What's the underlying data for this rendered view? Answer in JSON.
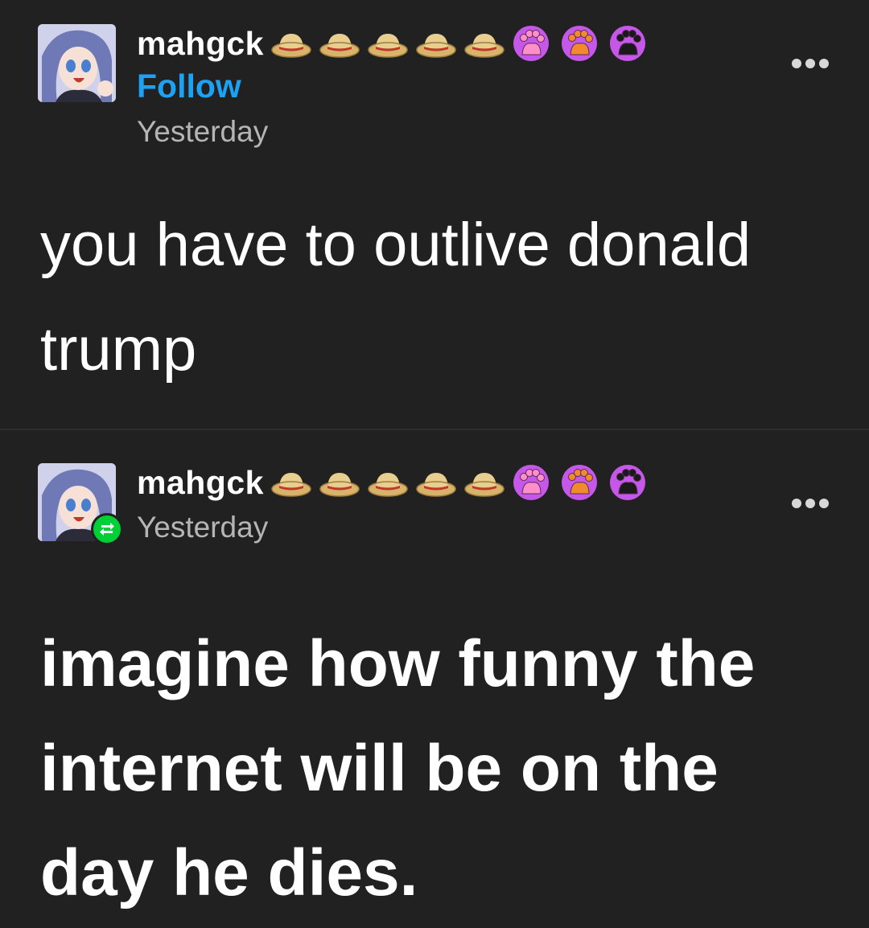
{
  "posts": [
    {
      "username": "mahgck",
      "follow_label": "Follow",
      "timestamp": "Yesterday",
      "body": "you have to outlive donald trump",
      "badges": [
        "straw-hat-icon",
        "straw-hat-icon",
        "straw-hat-icon",
        "straw-hat-icon",
        "straw-hat-icon",
        "paw-pink-icon",
        "paw-orange-icon",
        "paw-black-icon"
      ]
    },
    {
      "username": "mahgck",
      "timestamp": "Yesterday",
      "reblog_icon": "reblog-icon",
      "body": "imagine how funny the internet will be on the day he dies.",
      "badges": [
        "straw-hat-icon",
        "straw-hat-icon",
        "straw-hat-icon",
        "straw-hat-icon",
        "straw-hat-icon",
        "paw-pink-icon",
        "paw-orange-icon",
        "paw-black-icon"
      ]
    }
  ],
  "colors": {
    "background": "#212121",
    "follow": "#1da1f2",
    "timestamp": "#b5b5b5",
    "reblog_badge": "#00cf35",
    "badge_ring": "#c558e8"
  }
}
